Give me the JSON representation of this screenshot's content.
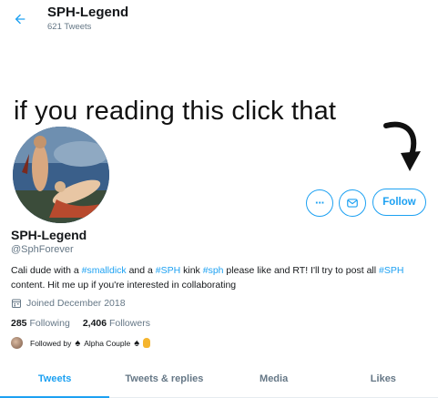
{
  "header": {
    "name": "SPH-Legend",
    "tweet_count": "621 Tweets"
  },
  "banner": {
    "text": "if you reading this click that"
  },
  "actions": {
    "follow_label": "Follow"
  },
  "profile": {
    "name": "SPH-Legend",
    "handle": "@SphForever",
    "bio": [
      {
        "t": "Cali dude with a ",
        "tag": false
      },
      {
        "t": "#smalldick",
        "tag": true
      },
      {
        "t": " and a ",
        "tag": false
      },
      {
        "t": "#SPH",
        "tag": true
      },
      {
        "t": " kink ",
        "tag": false
      },
      {
        "t": "#sph",
        "tag": true
      },
      {
        "t": " please like and RT! I'll try to post all ",
        "tag": false
      },
      {
        "t": "#SPH",
        "tag": true
      },
      {
        "t": " content. Hit me up if you're interested in collaborating",
        "tag": false
      }
    ],
    "joined": "Joined December 2018",
    "following_count": "285",
    "following_label": "Following",
    "followers_count": "2,406",
    "followers_label": "Followers",
    "followed_by_prefix": "Followed by",
    "followed_by_name": "Alpha Couple"
  },
  "tabs": [
    {
      "label": "Tweets",
      "active": true
    },
    {
      "label": "Tweets & replies",
      "active": false
    },
    {
      "label": "Media",
      "active": false
    },
    {
      "label": "Likes",
      "active": false
    }
  ],
  "colors": {
    "accent": "#1da1f2",
    "secondary_text": "#657786"
  }
}
